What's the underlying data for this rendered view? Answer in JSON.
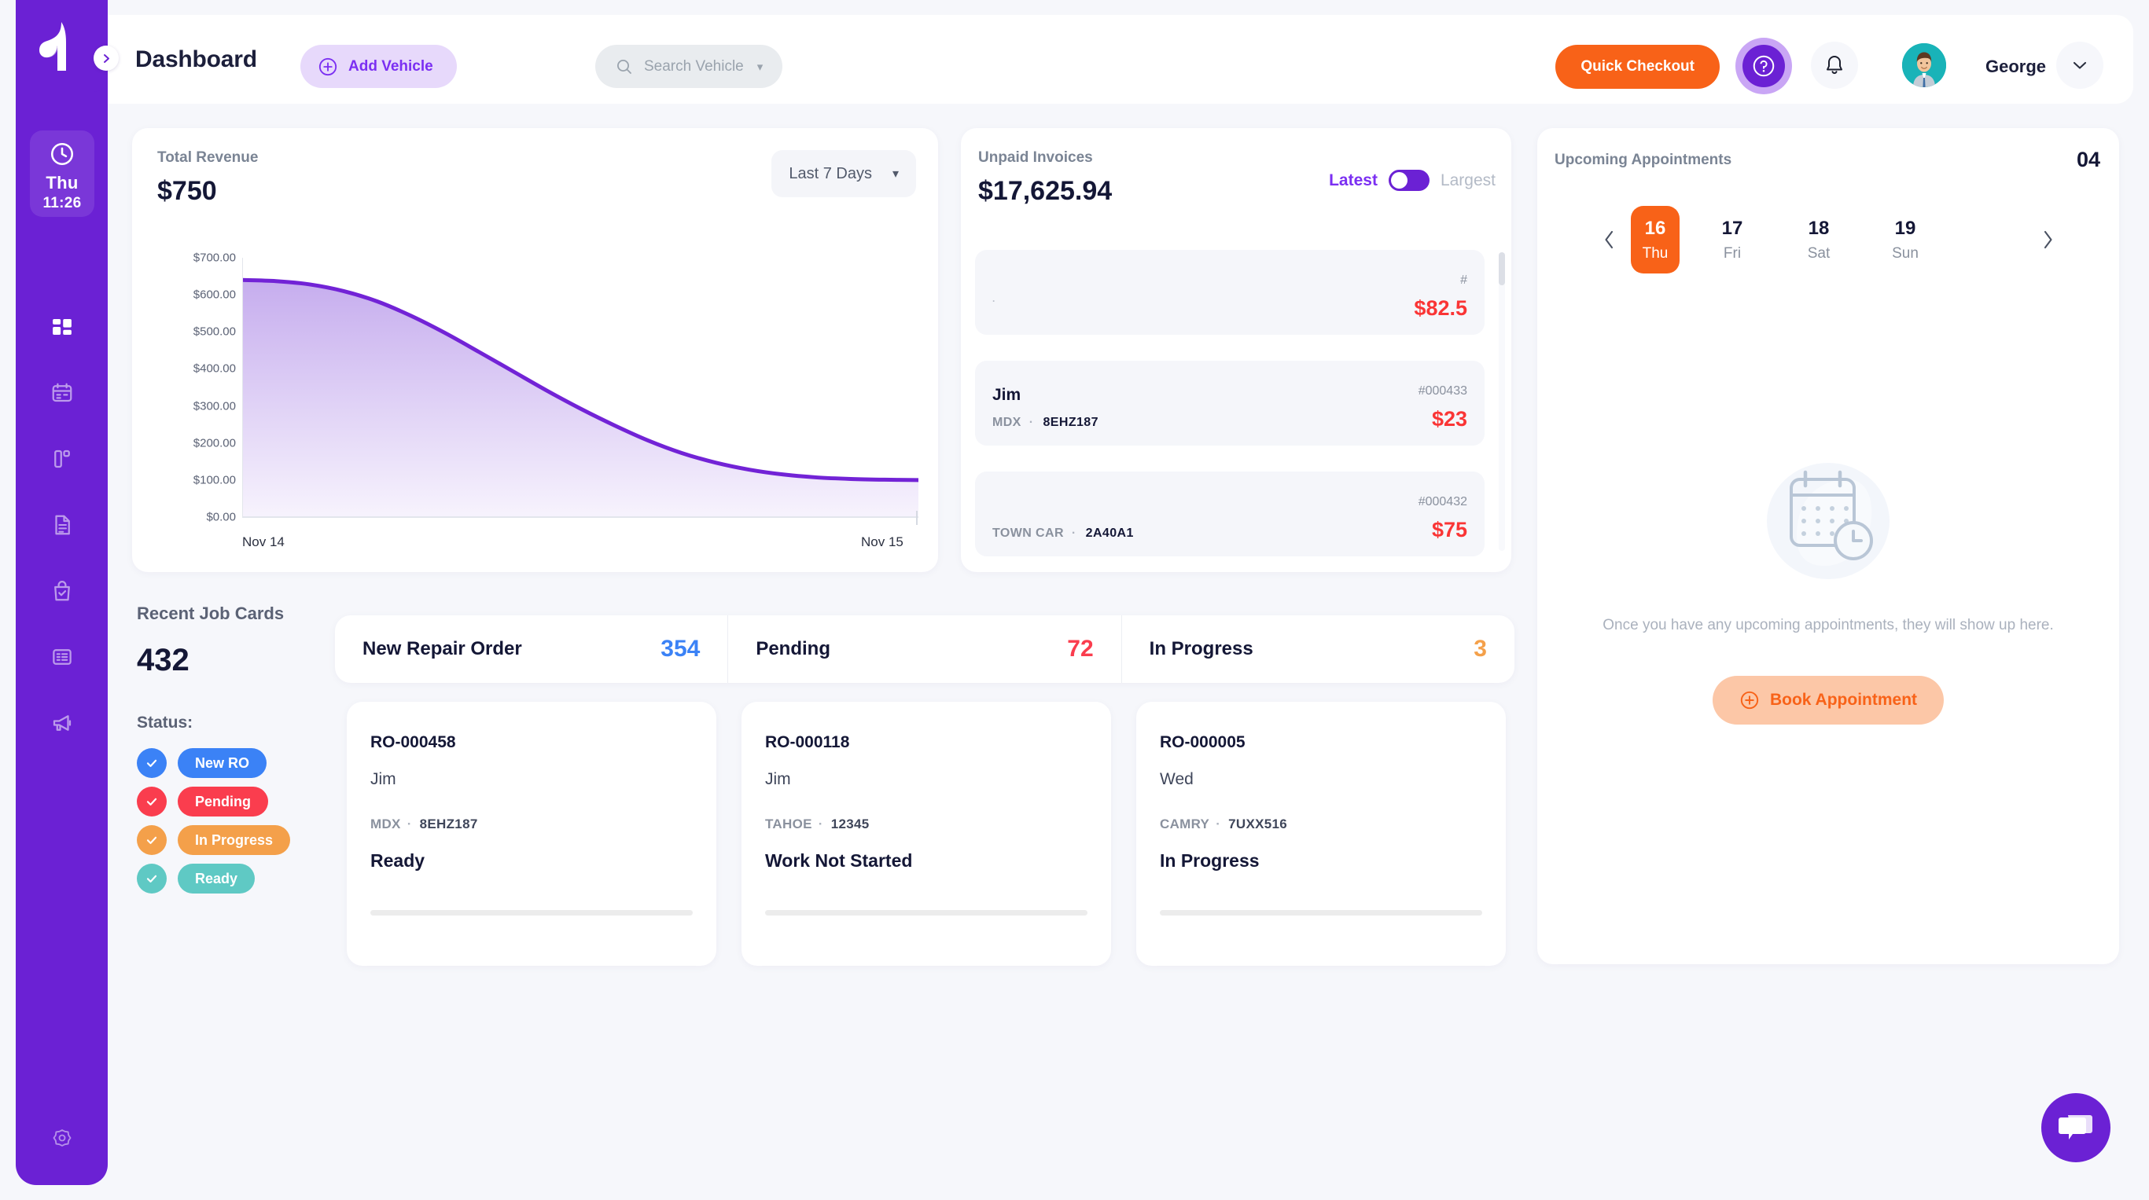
{
  "brand": {
    "logo_icon": "tekmetric-leaf-logo",
    "expand_icon": "chevron-right-icon"
  },
  "sidebar": {
    "clock": {
      "icon": "clock-icon",
      "day": "Thu",
      "time": "11:26"
    },
    "items": [
      {
        "name": "dashboard",
        "icon": "grid-icon",
        "active": true
      },
      {
        "name": "calendar",
        "icon": "calendar-icon",
        "active": false
      },
      {
        "name": "board",
        "icon": "kanban-icon",
        "active": false
      },
      {
        "name": "documents",
        "icon": "document-icon",
        "active": false
      },
      {
        "name": "parts",
        "icon": "shopping-bag-check-icon",
        "active": false
      },
      {
        "name": "reports",
        "icon": "list-report-icon",
        "active": false
      },
      {
        "name": "marketing",
        "icon": "megaphone-icon",
        "active": false
      }
    ],
    "settings": {
      "icon": "gear-icon"
    }
  },
  "header": {
    "title": "Dashboard",
    "add_vehicle": {
      "label": "Add Vehicle",
      "icon": "plus-circle-icon"
    },
    "search": {
      "placeholder": "Search Vehicle",
      "icon": "search-icon",
      "caret": "chevron-down-icon"
    },
    "quick_checkout": "Quick Checkout",
    "help_icon": "question-circle-icon",
    "notification_icon": "bell-icon",
    "avatar_icon": "user-avatar",
    "user_name": "George",
    "user_caret_icon": "chevron-down-icon"
  },
  "revenue": {
    "title": "Total Revenue",
    "amount": "$750",
    "range_label": "Last 7 Days",
    "range_caret_icon": "chevron-down-icon"
  },
  "chart_data": {
    "type": "area",
    "title": "Total Revenue",
    "xlabel": "",
    "ylabel": "",
    "x": [
      "Nov 14",
      "Nov 15"
    ],
    "tick_labels_x": [
      "Nov 14",
      "Nov 15"
    ],
    "tick_labels_y": [
      "$0.00",
      "$100.00",
      "$200.00",
      "$300.00",
      "$400.00",
      "$500.00",
      "$600.00",
      "$700.00"
    ],
    "ylim": [
      0,
      700
    ],
    "yticks": [
      0,
      100,
      200,
      300,
      400,
      500,
      600,
      700
    ],
    "grid": false,
    "legend": false,
    "line_color": "#7223d6",
    "fill_color": "#cdb8ef",
    "series": [
      {
        "name": "Revenue",
        "values": [
          640,
          637,
          628,
          610,
          582,
          543,
          497,
          446,
          394,
          342,
          293,
          248,
          207,
          173,
          147,
          128,
          115,
          107,
          103,
          101,
          100
        ]
      }
    ]
  },
  "invoices": {
    "title": "Unpaid Invoices",
    "amount": "$17,625.94",
    "toggle": {
      "left": "Latest",
      "right": "Largest",
      "selected": "Latest"
    },
    "rows": [
      {
        "name": ".",
        "number": "#",
        "vehicle": "",
        "plate": "",
        "amount": "$82.5"
      },
      {
        "name": "Jim",
        "number": "#000433",
        "vehicle": "MDX",
        "plate": "8EHZ187",
        "amount": "$23"
      },
      {
        "name": "",
        "number": "#000432",
        "vehicle": "TOWN CAR",
        "plate": "2A40A1",
        "amount": "$75"
      }
    ]
  },
  "appointments": {
    "title": "Upcoming Appointments",
    "count": "04",
    "prev_icon": "chevron-left-icon",
    "next_icon": "chevron-right-icon",
    "days": [
      {
        "num": "16",
        "dow": "Thu",
        "active": true
      },
      {
        "num": "17",
        "dow": "Fri",
        "active": false
      },
      {
        "num": "18",
        "dow": "Sat",
        "active": false
      },
      {
        "num": "19",
        "dow": "Sun",
        "active": false
      }
    ],
    "empty_icon": "calendar-clock-icon",
    "empty_text": "Once you have any upcoming appointments, they will show up here.",
    "book_button": {
      "label": "Book Appointment",
      "icon": "plus-circle-icon"
    }
  },
  "job_cards": {
    "title": "Recent Job Cards",
    "count": "432",
    "status_label": "Status:",
    "statuses": [
      {
        "label": "New RO",
        "color": "#3b82f6",
        "checked": true
      },
      {
        "label": "Pending",
        "color": "#fa3d4e",
        "checked": true
      },
      {
        "label": "In Progress",
        "color": "#f4a04a",
        "checked": true
      },
      {
        "label": "Ready",
        "color": "#5fc9c4",
        "checked": true
      }
    ],
    "stats": [
      {
        "label": "New Repair Order",
        "value": "354",
        "color": "#3b82f6"
      },
      {
        "label": "Pending",
        "value": "72",
        "color": "#fa3d4e"
      },
      {
        "label": "In Progress",
        "value": "3",
        "color": "#f4a04a"
      }
    ],
    "cards": [
      {
        "ro": "RO-000458",
        "customer": "Jim",
        "vehicle": "MDX",
        "plate": "8EHZ187",
        "state": "Ready"
      },
      {
        "ro": "RO-000118",
        "customer": "Jim",
        "vehicle": "TAHOE",
        "plate": "12345",
        "state": "Work Not Started"
      },
      {
        "ro": "RO-000005",
        "customer": "Wed",
        "vehicle": "CAMRY",
        "plate": "7UXX516",
        "state": "In Progress"
      }
    ]
  },
  "chat": {
    "icon": "chat-bubbles-icon"
  },
  "colors": {
    "brand_purple": "#6b21d4",
    "accent_orange": "#f86218",
    "danger_red": "#fa3535",
    "page_bg": "#f6f7fb"
  }
}
